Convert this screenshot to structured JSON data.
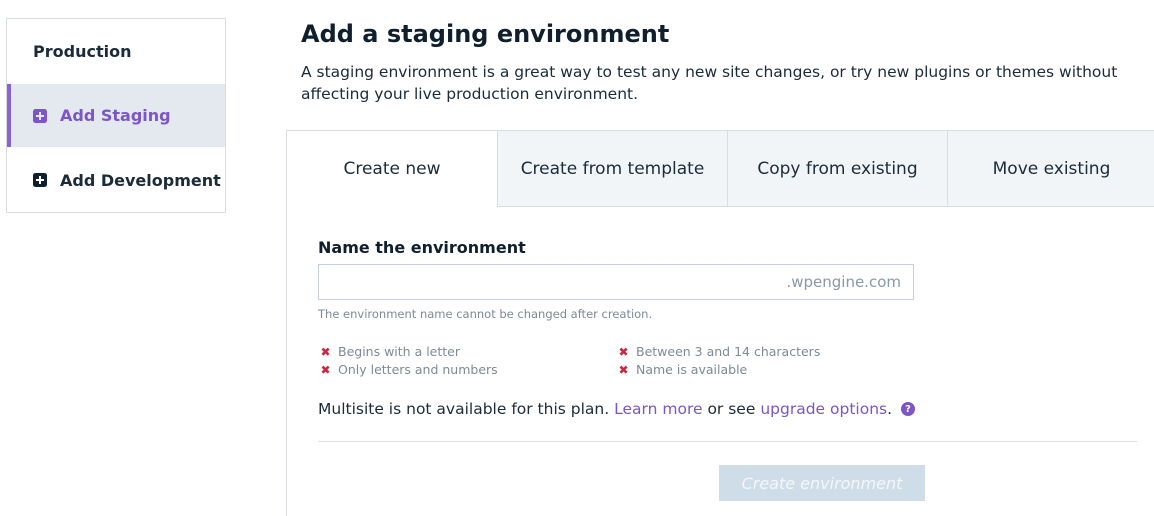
{
  "sidebar": {
    "items": [
      {
        "label": "Production"
      },
      {
        "label": "Add Staging",
        "icon": "plus-square-icon"
      },
      {
        "label": "Add Development",
        "icon": "plus-square-icon"
      }
    ]
  },
  "header": {
    "title": "Add a staging environment",
    "description": "A staging environment is a great way to test any new site changes, or try new plugins or themes without affecting your live production environment."
  },
  "tabs": [
    {
      "label": "Create new",
      "active": true
    },
    {
      "label": "Create from template"
    },
    {
      "label": "Copy from existing"
    },
    {
      "label": "Move existing"
    }
  ],
  "form": {
    "field_label": "Name the environment",
    "input_value": "",
    "domain_suffix": ".wpengine.com",
    "help_text": "The environment name cannot be changed after creation.",
    "rules": [
      {
        "text": "Begins with a letter",
        "icon": "x-icon"
      },
      {
        "text": "Only letters and numbers",
        "icon": "x-icon"
      },
      {
        "text": "Between 3 and 14 characters",
        "icon": "x-icon"
      },
      {
        "text": "Name is available",
        "icon": "x-icon"
      }
    ],
    "multisite": {
      "prefix": "Multisite is not available for this plan.",
      "learn_more": "Learn more",
      "middle": "or see",
      "upgrade": "upgrade options",
      "suffix": ".",
      "help_icon": "question-circle-icon"
    },
    "submit_label": "Create environment"
  },
  "colors": {
    "accent": "#7c55c9",
    "error": "#c62840",
    "button_disabled": "#cfdde9"
  }
}
